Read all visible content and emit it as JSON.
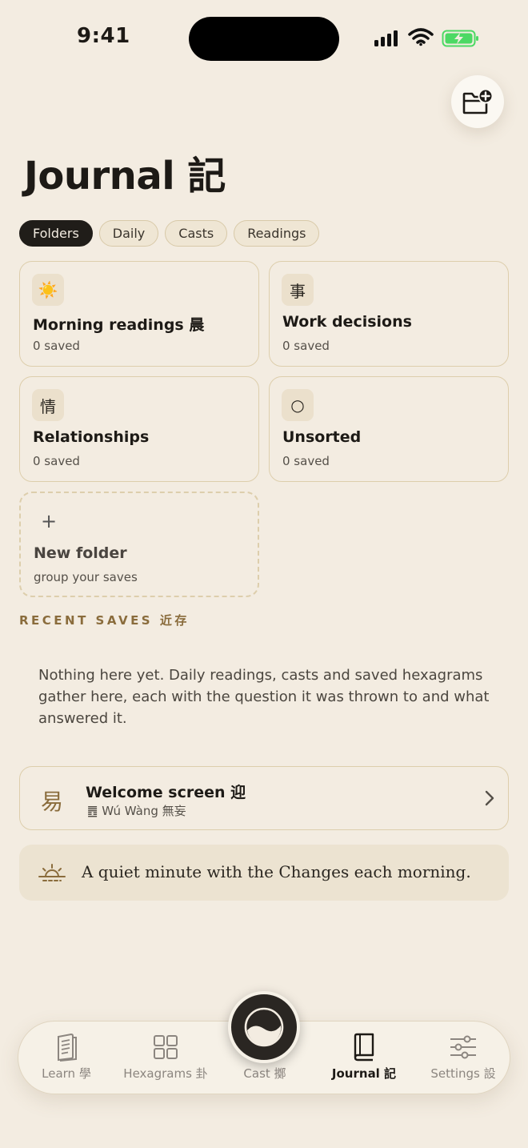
{
  "status": {
    "time": "9:41"
  },
  "header": {
    "title": "Journal 記"
  },
  "filters": [
    "Folders",
    "Daily",
    "Casts",
    "Readings"
  ],
  "folders": [
    {
      "glyph": "☀️",
      "name": "Morning readings 晨",
      "count": "0 saved"
    },
    {
      "glyph": "事",
      "name": "Work decisions",
      "count": "0 saved"
    },
    {
      "glyph": "情",
      "name": "Relationships",
      "count": "0 saved"
    },
    {
      "glyph": "○",
      "name": "Unsorted",
      "count": "0 saved"
    }
  ],
  "new_folder": {
    "glyph": "+",
    "name": "New folder",
    "subtitle": "group your saves"
  },
  "recent": {
    "label": "RECENT SAVES  近存",
    "empty_text": "Nothing here yet. Daily readings, casts and saved hexagrams gather here, each with the question it was thrown to and what answered it."
  },
  "welcome": {
    "glyph": "易",
    "title": "Welcome screen 迎",
    "subtitle": "䷘ Wú Wàng 無妄"
  },
  "quote": {
    "text": "A quiet minute with the Changes each morning."
  },
  "tabs": [
    {
      "label": "Learn 學"
    },
    {
      "label": "Hexagrams 卦"
    },
    {
      "label": "Cast 擲"
    },
    {
      "label": "Journal 記"
    },
    {
      "label": "Settings 設"
    }
  ],
  "colors": {
    "background": "#f3ece1",
    "accent": "#8a6c3c",
    "active_chip": "#201d19",
    "battery": "#4cd964"
  }
}
